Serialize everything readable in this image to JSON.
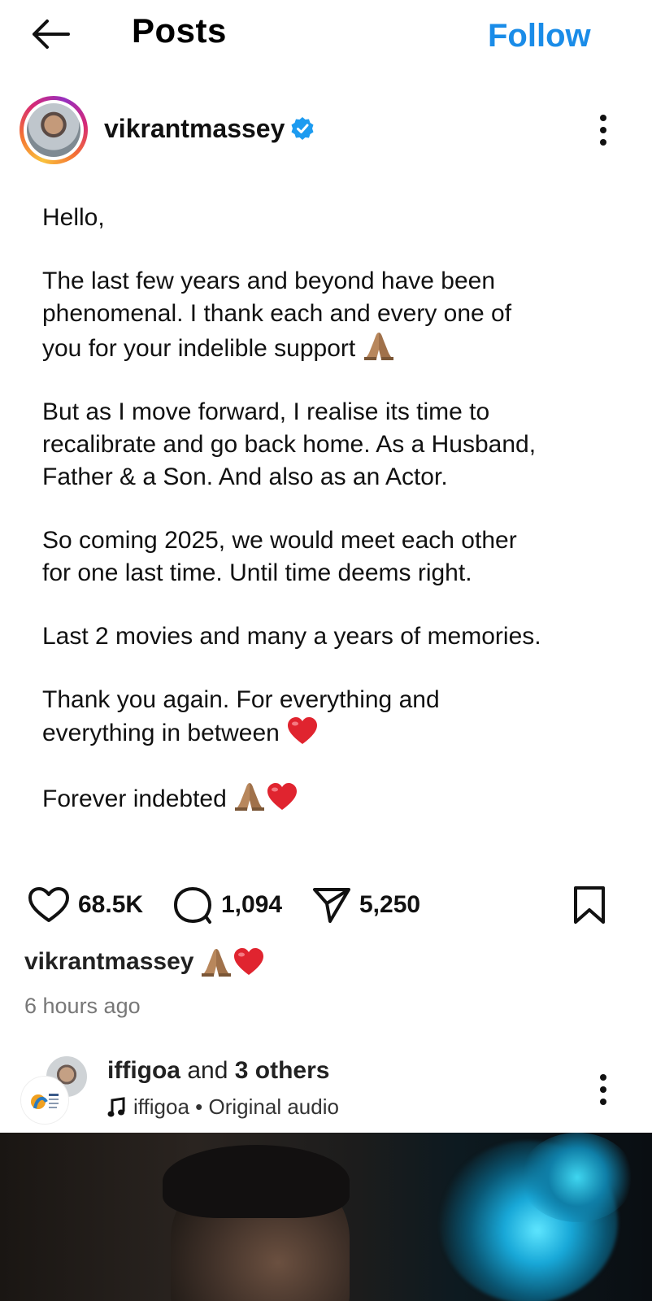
{
  "topbar": {
    "back_icon": "arrow-left-icon",
    "title": "Posts",
    "follow_label": "Follow",
    "accent_color": "#1a8ce8"
  },
  "post": {
    "username": "vikrantmassey",
    "verified_icon": "verified-badge-icon",
    "more_icon": "more-vertical-icon",
    "caption": {
      "greeting": "Hello,",
      "p1": "The last few years and beyond have been\nphenomenal. I thank each and every one of\nyou for your indelible support",
      "p2": "But as I move forward, I realise its time to\nrecalibrate and go back home. As a Husband,\nFather & a Son. And also as an Actor.",
      "p3": "So coming 2025, we would meet each other\nfor one last time. Until time deems right.",
      "p4": "Last 2 movies and many a years of memories.",
      "p5": "Thank you again. For everything and\neverything in between",
      "p6": "Forever indebted"
    },
    "likes": "68.5K",
    "comments": "1,094",
    "shares": "5,250",
    "like_icon": "heart-outline-icon",
    "comment_icon": "comment-icon",
    "share_icon": "send-icon",
    "save_icon": "bookmark-icon",
    "caption_author": "vikrantmassey",
    "timestamp": "6 hours ago"
  },
  "next_post": {
    "title_user": "iffigoa",
    "title_and": "and",
    "title_others": "3 others",
    "audio_icon": "music-note-icon",
    "audio_user": "iffigoa",
    "audio_sep": "•",
    "audio_label": "Original audio",
    "more_icon": "more-vertical-icon"
  }
}
